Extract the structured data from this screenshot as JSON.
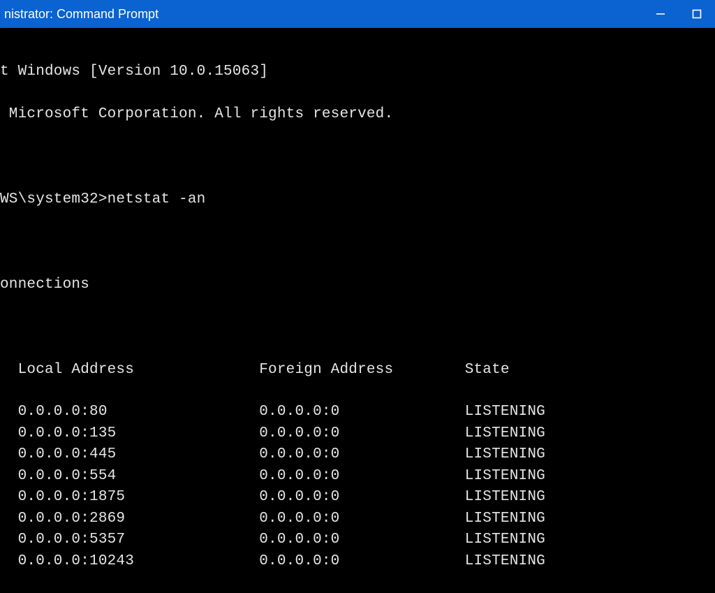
{
  "titlebar": {
    "title": "nistrator: Command Prompt"
  },
  "terminal": {
    "version_line": "t Windows [Version 10.0.15063]",
    "copyright_line": " Microsoft Corporation. All rights reserved.",
    "prompt_line": "WS\\system32>netstat -an",
    "section_header": "onnections",
    "columns": {
      "local": "Local Address",
      "foreign": "Foreign Address",
      "state": "State"
    },
    "rows": [
      {
        "local": "0.0.0.0:80",
        "foreign": "0.0.0.0:0",
        "state": "LISTENING"
      },
      {
        "local": "0.0.0.0:135",
        "foreign": "0.0.0.0:0",
        "state": "LISTENING"
      },
      {
        "local": "0.0.0.0:445",
        "foreign": "0.0.0.0:0",
        "state": "LISTENING"
      },
      {
        "local": "0.0.0.0:554",
        "foreign": "0.0.0.0:0",
        "state": "LISTENING"
      },
      {
        "local": "0.0.0.0:1875",
        "foreign": "0.0.0.0:0",
        "state": "LISTENING"
      },
      {
        "local": "0.0.0.0:2869",
        "foreign": "0.0.0.0:0",
        "state": "LISTENING"
      },
      {
        "local": "0.0.0.0:5357",
        "foreign": "0.0.0.0:0",
        "state": "LISTENING"
      },
      {
        "local": "0.0.0.0:10243",
        "foreign": "0.0.0.0:0",
        "state": "LISTENING"
      }
    ]
  }
}
